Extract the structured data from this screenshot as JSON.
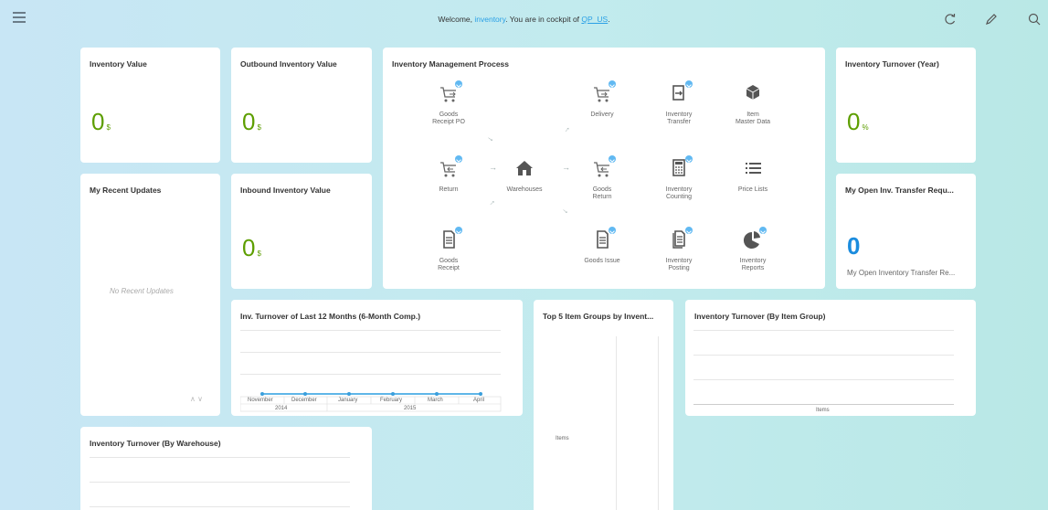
{
  "header": {
    "welcome_prefix": "Welcome, ",
    "user": "inventory",
    "welcome_middle": ". You are in cockpit of ",
    "cockpit": "QP_US",
    "welcome_suffix": "."
  },
  "tiles": {
    "inventory_value": {
      "title": "Inventory Value",
      "value": "0",
      "unit": "$"
    },
    "outbound_value": {
      "title": "Outbound Inventory Value",
      "value": "0",
      "unit": "$"
    },
    "inbound_value": {
      "title": "Inbound Inventory Value",
      "value": "0",
      "unit": "$"
    },
    "turnover_year": {
      "title": "Inventory Turnover (Year)",
      "value": "0",
      "unit": "%"
    },
    "open_transfer": {
      "title": "My Open Inv. Transfer Requ...",
      "value": "0",
      "subtitle": "My Open Inventory Transfer Re..."
    },
    "recent_updates": {
      "title": "My Recent Updates",
      "empty": "No Recent Updates"
    },
    "process": {
      "title": "Inventory Management Process"
    },
    "turnover_12": {
      "title": "Inv. Turnover of Last 12 Months (6-Month Comp.)",
      "months": [
        "November",
        "December",
        "January",
        "February",
        "March",
        "April"
      ],
      "years": [
        "2014",
        "2015"
      ]
    },
    "top5": {
      "title": "Top 5 Item Groups by Invent...",
      "axis": "Items"
    },
    "turnover_group": {
      "title": "Inventory Turnover (By Item Group)",
      "axis": "Items"
    },
    "turnover_warehouse": {
      "title": "Inventory Turnover (By Warehouse)"
    }
  },
  "process": {
    "goods_receipt_po": "Goods\nReceipt PO",
    "delivery": "Delivery",
    "inventory_transfer": "Inventory\nTransfer",
    "item_master_data": "Item\nMaster Data",
    "return": "Return",
    "warehouses": "Warehouses",
    "goods_return": "Goods\nReturn",
    "inventory_counting": "Inventory\nCounting",
    "price_lists": "Price Lists",
    "goods_receipt": "Goods\nReceipt",
    "goods_issue": "Goods Issue",
    "inventory_posting": "Inventory\nPosting",
    "inventory_reports": "Inventory\nReports"
  },
  "colors": {
    "kpi_green": "#5d9e00",
    "kpi_blue": "#1b8cde",
    "link_blue": "#2aa0e6",
    "badge_blue": "#61b9f2"
  },
  "icons": [
    "menu-icon",
    "refresh-icon",
    "edit-icon",
    "search-icon"
  ]
}
